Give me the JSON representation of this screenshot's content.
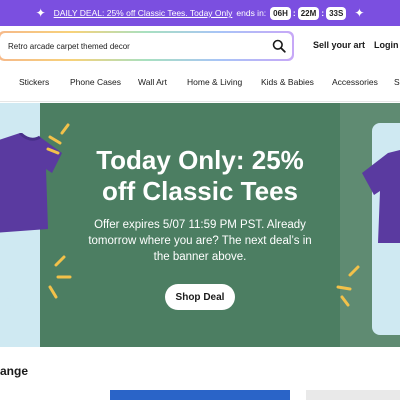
{
  "promo": {
    "deal_text": "DAILY DEAL: 25% off Classic Tees. Today Only",
    "ends_in": "ends in:",
    "countdown": {
      "hours": "06H",
      "minutes": "22M",
      "seconds": "33S"
    },
    "bg_color": "#7b4fe0"
  },
  "header": {
    "search_value": "Retro arcade carpet themed decor",
    "sell_label": "Sell your art",
    "login_label": "Login"
  },
  "categories": [
    "Stickers",
    "Phone Cases",
    "Wall Art",
    "Home & Living",
    "Kids & Babies",
    "Accessories",
    "S"
  ],
  "hero": {
    "title_line1": "Today Only: 25%",
    "title_line2": "off Classic Tees",
    "subtitle_line1": "Offer expires 5/07 11:59 PM PST. Already",
    "subtitle_line2": "tomorrow where you are? The next deal’s in",
    "subtitle_line3": "the banner above.",
    "button_label": "Shop Deal",
    "bg_color": "#4c7e62"
  },
  "section": {
    "title_fragment": "ange"
  }
}
